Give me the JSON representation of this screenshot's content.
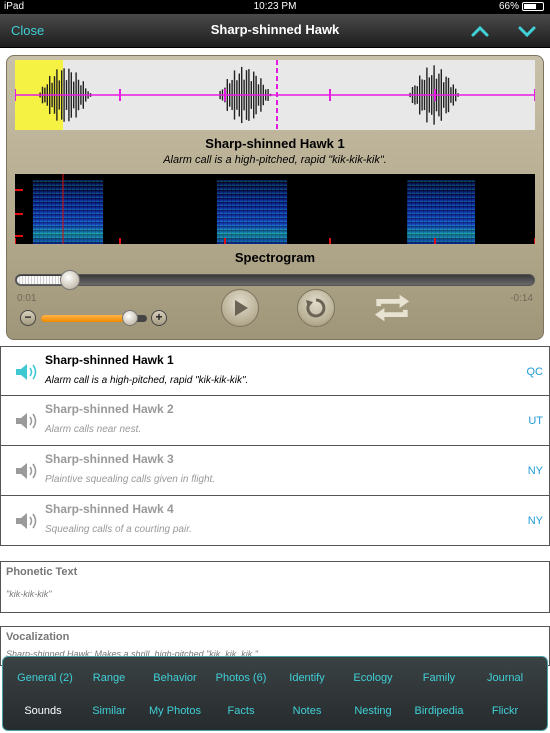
{
  "status": {
    "device": "iPad",
    "time": "10:23 PM",
    "battery": "66%",
    "battery_level": 0.66
  },
  "nav": {
    "close_label": "Close",
    "title": "Sharp-shinned Hawk",
    "up_icon": "chevron-up-icon",
    "down_icon": "chevron-down-icon",
    "accent": "#3fd0d8"
  },
  "player": {
    "title": "Sharp-shinned Hawk 1",
    "subtitle": "Alarm call is a high-pitched, rapid \"kik-kik-kik\".",
    "spectrogram_label": "Spectrogram",
    "elapsed": "0:01",
    "remaining": "-0:14",
    "progress": 0.1,
    "volume": 0.84,
    "volume_minus": "−",
    "volume_plus": "+",
    "controls": [
      "play-icon",
      "replay-icon",
      "loop-icon"
    ]
  },
  "recordings": [
    {
      "name": "Sharp-shinned Hawk 1",
      "desc": "Alarm call is a high-pitched, rapid \"kik-kik-kik\".",
      "code": "QC",
      "active": true
    },
    {
      "name": "Sharp-shinned Hawk 2",
      "desc": "Alarm calls near nest.",
      "code": "UT",
      "active": false
    },
    {
      "name": "Sharp-shinned Hawk 3",
      "desc": "Plaintive squealing calls given in flight.",
      "code": "NY",
      "active": false
    },
    {
      "name": "Sharp-shinned Hawk 4",
      "desc": "Squealing calls of a courting pair.",
      "code": "NY",
      "active": false
    }
  ],
  "phonetic": {
    "heading": "Phonetic Text",
    "body": "\"kik-kik-kik\""
  },
  "vocalization": {
    "heading": "Vocalization",
    "body": "Sharp-shinned Hawk: Makes a shrill, high-pitched \"kik, kik, kik.\""
  },
  "tabs": {
    "row1": [
      "General (2)",
      "Range",
      "Behavior",
      "Photos (6)",
      "Identify",
      "Ecology",
      "Family",
      "Journal"
    ],
    "row2": [
      "Sounds",
      "Similar",
      "My Photos",
      "Facts",
      "Notes",
      "Nesting",
      "Birdipedia",
      "Flickr"
    ],
    "current": "Sounds"
  }
}
